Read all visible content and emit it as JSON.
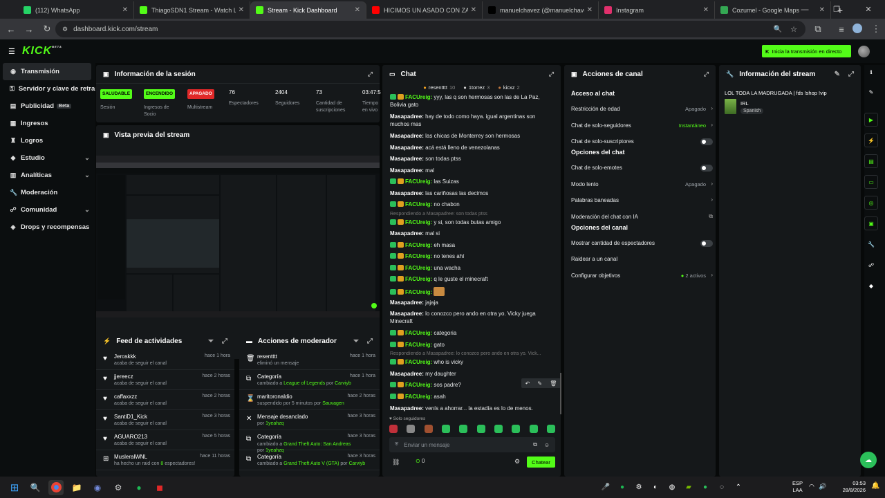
{
  "browser": {
    "tabs": [
      {
        "title": "(112) WhatsApp",
        "color": "#25d366"
      },
      {
        "title": "ThiagoSDN1 Stream - Watch Li",
        "color": "#53fc18"
      },
      {
        "title": "Stream - Kick Dashboard",
        "color": "#53fc18"
      },
      {
        "title": "HICIMOS UN ASADO CON ZAR",
        "color": "#ff0000"
      },
      {
        "title": "manuelchavez (@manuelchave",
        "color": "#000000"
      },
      {
        "title": "Instagram",
        "color": "#e1306c"
      },
      {
        "title": "Cozumel - Google Maps",
        "color": "#34a853"
      }
    ],
    "url": "dashboard.kick.com/stream"
  },
  "topnav": {
    "logo": "KICK",
    "logo_beta": "BETA",
    "go_live": "Inicia la transmisión en directo"
  },
  "sidebar": {
    "items": [
      {
        "label": "Transmisión",
        "icon": "broadcast-icon"
      },
      {
        "label": "Servidor y clave de retransmisión",
        "icon": "key-icon"
      },
      {
        "label": "Publicidad",
        "icon": "ad-icon",
        "badge": "Beta"
      },
      {
        "label": "Ingresos",
        "icon": "money-icon"
      },
      {
        "label": "Logros",
        "icon": "trophy-icon"
      },
      {
        "label": "Estudio",
        "icon": "studio-icon"
      },
      {
        "label": "Analíticas",
        "icon": "analytics-icon"
      },
      {
        "label": "Moderación",
        "icon": "wrench-icon"
      },
      {
        "label": "Comunidad",
        "icon": "community-icon"
      },
      {
        "label": "Drops y recompensas",
        "icon": "gift-icon"
      }
    ]
  },
  "session": {
    "title": "Información de la sesión",
    "stats": [
      {
        "badge": "SALUDABLE",
        "label": "Sesión",
        "badge_color": "#53fc18",
        "badge_text": "#000000"
      },
      {
        "badge": "ENCENDIDO",
        "label": "Ingresos de Socio",
        "badge_color": "#53fc18",
        "badge_text": "#000000"
      },
      {
        "badge": "APAGADO",
        "label": "Multistream",
        "badge_color": "#e02828",
        "badge_text": "#ffffff"
      },
      {
        "value": "76",
        "label": "Espectadores"
      },
      {
        "value": "2404",
        "label": "Seguidores"
      },
      {
        "value": "73",
        "label": "Cantidad de suscripciones"
      },
      {
        "value": "03:47:5",
        "label": "Tiempo en vivo"
      }
    ]
  },
  "preview": {
    "title": "Vista previa del stream"
  },
  "feed": {
    "title": "Feed de actividades",
    "items": [
      {
        "name": "Jeroskkk",
        "sub": "acaba de seguir el canal",
        "time": "hace 1 hora"
      },
      {
        "name": "jjereecz",
        "sub": "acaba de seguir el canal",
        "time": "hace 2 horas"
      },
      {
        "name": "caffaxxzz",
        "sub": "acaba de seguir el canal",
        "time": "hace 2 horas"
      },
      {
        "name": "SantiD1_Kick",
        "sub": "acaba de seguir el canal",
        "time": "hace 3 horas"
      },
      {
        "name": "AGUARO213",
        "sub": "acaba de seguir el canal",
        "time": "hace 5 horas"
      },
      {
        "name": "MusleralWNL",
        "sub_pre": "ha hecho un raid con",
        "sub_hl": "8",
        "sub_post": "espectadores!",
        "time": "hace 11 horas"
      }
    ]
  },
  "modactions": {
    "title": "Acciones de moderador",
    "items": [
      {
        "name": "resentttt",
        "sub": "eliminó un mensaje",
        "time": "hace 1 hora",
        "icon": "trash-icon"
      },
      {
        "name": "Categoría",
        "sub": "cambiado a",
        "hl": "League of Legends",
        "by": "Carviyb",
        "time": "hace 1 hora",
        "icon": "category-icon"
      },
      {
        "name": "maritoronaldio",
        "sub": "suspendido por 5 minutos por",
        "hl": "Sauvagen",
        "time": "hace 2 horas",
        "icon": "hourglass-icon"
      },
      {
        "name": "Mensaje desanclado",
        "sub": "por",
        "hl": "1yeahzq",
        "time": "hace 3 horas",
        "icon": "unpin-icon"
      },
      {
        "name": "Categoría",
        "sub": "cambiado a",
        "hl": "Grand Theft Auto: San Andreas",
        "by": "1yeahzq",
        "time": "hace 3 horas",
        "icon": "category-icon"
      },
      {
        "name": "Categoría",
        "sub": "cambiado a",
        "hl": "Grand Theft Auto V (GTA)",
        "by": "Carviyb",
        "time": "hace 3 horas",
        "icon": "category-icon"
      }
    ]
  },
  "chat": {
    "title": "Chat",
    "top_users": [
      {
        "name": "resentttt",
        "count": "10"
      },
      {
        "name": "1torrez",
        "count": "3"
      },
      {
        "name": "kicxz",
        "count": "2"
      }
    ],
    "messages": [
      {
        "user": "FACUreig:",
        "green": true,
        "text": "yyy, las q son hermosas son las de La Paz, Bolivia gato"
      },
      {
        "user": "Masapadree:",
        "green": false,
        "text": "hay de todo como haya. igual argentinas son muchos mas"
      },
      {
        "user": "Masapadree:",
        "green": false,
        "text": "las chicas de Monterrey son hermosas"
      },
      {
        "user": "Masapadree:",
        "green": false,
        "text": "acá está lleno de venezolanas"
      },
      {
        "user": "Masapadree:",
        "green": false,
        "text": "son todas ptss"
      },
      {
        "user": "Masapadree:",
        "green": false,
        "text": "mal"
      },
      {
        "user": "FACUreig:",
        "green": true,
        "text": "las Suizas"
      },
      {
        "user": "Masapadree:",
        "green": false,
        "text": "las cariñosas las decimos"
      },
      {
        "user": "FACUreig:",
        "green": true,
        "text": "no chabon"
      },
      {
        "reply": "Respondiendo a Masapadree: son todas ptss"
      },
      {
        "user": "FACUreig:",
        "green": true,
        "text": "y si, son todas butas amigo"
      },
      {
        "user": "Masapadree:",
        "green": false,
        "text": "mal si"
      },
      {
        "user": "FACUreig:",
        "green": true,
        "text": "eh masa"
      },
      {
        "user": "FACUreig:",
        "green": true,
        "text": "no tenes ahí"
      },
      {
        "user": "FACUreig:",
        "green": true,
        "text": "una wacha"
      },
      {
        "user": "FACUreig:",
        "green": true,
        "text": "q le guste el minecraft"
      },
      {
        "user": "FACUreig:",
        "green": true,
        "text": ""
      },
      {
        "user": "Masapadree:",
        "green": false,
        "text": "jajaja"
      },
      {
        "user": "Masapadree:",
        "green": false,
        "text": "lo conozco pero ando en otra yo. Vicky juega Minecraft"
      },
      {
        "user": "FACUreig:",
        "green": true,
        "text": "categoria"
      },
      {
        "user": "FACUreig:",
        "green": true,
        "text": "gato"
      },
      {
        "reply": "Respondiendo a Masapadree: lo conozco pero ando en otra yo. Vick..."
      },
      {
        "user": "FACUreig:",
        "green": true,
        "text": "who is vicky"
      },
      {
        "user": "Masapadree:",
        "green": false,
        "text": "my daughter"
      },
      {
        "user": "FACUreig:",
        "green": true,
        "text": "sos padre?"
      },
      {
        "user": "FACUreig:",
        "green": true,
        "text": "asah"
      },
      {
        "user": "Masapadree:",
        "green": false,
        "text": "venís a ahorrar... la estadía es lo de menos."
      }
    ],
    "followers_only": "Solo seguidores",
    "placeholder": "Enviar un mensaje",
    "points": "0",
    "send": "Chatear"
  },
  "channel": {
    "title": "Acciones de canal",
    "sections": [
      {
        "heading": "Acceso al chat",
        "rows": [
          {
            "label": "Restricción de edad",
            "value": "Apagado",
            "type": "chev"
          },
          {
            "label": "Chat de solo-seguidores",
            "value": "Instantáneo",
            "type": "chev",
            "green": true
          },
          {
            "label": "Chat de solo-suscriptores",
            "type": "toggle"
          }
        ]
      },
      {
        "heading": "Opciones del chat",
        "rows": [
          {
            "label": "Chat de solo-emotes",
            "type": "toggle"
          },
          {
            "label": "Modo lento",
            "value": "Apagado",
            "type": "chev"
          },
          {
            "label": "Palabras baneadas",
            "type": "chev"
          },
          {
            "label": "Moderación del chat con IA",
            "type": "ext"
          }
        ]
      },
      {
        "heading": "Opciones del canal",
        "rows": [
          {
            "label": "Mostrar cantidad de espectadores",
            "type": "toggle"
          },
          {
            "label": "Raidear a un canal",
            "type": "none"
          },
          {
            "label": "Configurar objetivos",
            "value": "2 activos",
            "type": "chev"
          }
        ]
      }
    ]
  },
  "streaminfo": {
    "title": "Información del stream",
    "stream_title": "LOL TODA LA MADRUGADA | fds !shop !vip",
    "category": "IRL",
    "language": "Spanish"
  },
  "taskbar": {
    "lang": "ESP",
    "lang2": "LAA",
    "time": "03:53",
    "date": "28/8/2026"
  },
  "colors": {
    "accent": "#53fc18",
    "panel": "#15181a"
  }
}
